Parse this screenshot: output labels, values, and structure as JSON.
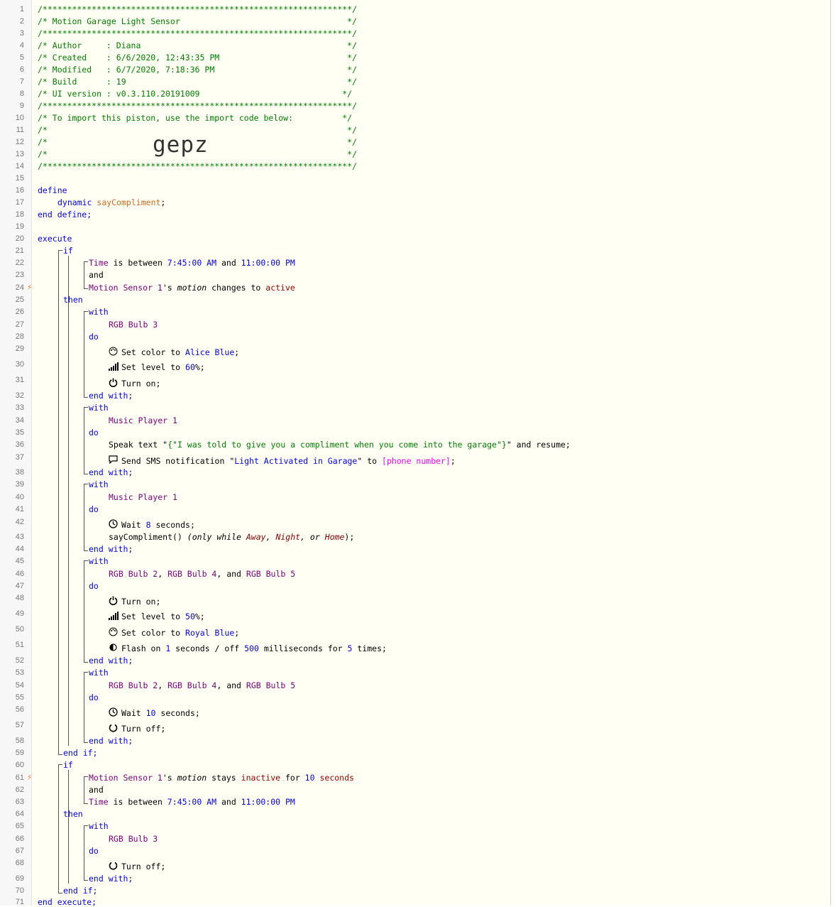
{
  "line_numbers": [
    "1",
    "2",
    "3",
    "4",
    "5",
    "6",
    "7",
    "8",
    "9",
    "10",
    "11",
    "12",
    "13",
    "14",
    "15",
    "16",
    "17",
    "18",
    "19",
    "20",
    "21",
    "22",
    "23",
    "24",
    "25",
    "26",
    "27",
    "28",
    "29",
    "30",
    "31",
    "32",
    "33",
    "34",
    "35",
    "36",
    "37",
    "38",
    "39",
    "40",
    "41",
    "42",
    "43",
    "44",
    "45",
    "46",
    "47",
    "48",
    "49",
    "50",
    "51",
    "52",
    "53",
    "54",
    "55",
    "56",
    "57",
    "58",
    "59",
    "60",
    "61",
    "62",
    "63",
    "64",
    "65",
    "66",
    "67",
    "68",
    "69",
    "70",
    "71"
  ],
  "header": {
    "border": "/***************************************************************/",
    "title": "/* Motion Garage Light Sensor                                  */",
    "author": "/* Author     : Diana                                          */",
    "created": "/* Created    : 6/6/2020, 12:43:35 PM                          */",
    "modified": "/* Modified   : 6/7/2020, 7:18:36 PM                           */",
    "build": "/* Build      : 19                                             */",
    "ui_version": "/* UI version : v0.3.110.20191009                             */",
    "import_note": "/* To import this piston, use the import code below:          */",
    "blank": "/*                                                             */",
    "import_code": "gepz"
  },
  "kw": {
    "define": "define",
    "dynamic": "dynamic",
    "end_define": "end define;",
    "execute": "execute",
    "if": "if",
    "and": "and",
    "then": "then",
    "with": "with",
    "do": "do",
    "end_with": "end with;",
    "end_if": "end if;",
    "end_execute": "end execute;"
  },
  "vars": {
    "say_compliment": "sayCompliment"
  },
  "devices": {
    "time": "Time",
    "motion_sensor": "Motion Sensor 1",
    "rgb_bulb_3": "RGB Bulb 3",
    "music_player": "Music Player 1",
    "rgb_bulb_2": "RGB Bulb 2",
    "rgb_bulb_4": "RGB Bulb 4",
    "rgb_bulb_5": "RGB Bulb 5"
  },
  "text": {
    "is_between": " is between ",
    "and_sp": " and ",
    "possessive": "'s ",
    "motion": "motion",
    "changes_to": " changes to ",
    "active": "active",
    "stays": " stays ",
    "inactive": "inactive",
    "for_sp": " for ",
    "seconds": "seconds",
    "set_color_to": "Set color to ",
    "set_level_to": "Set level to ",
    "pct": "%;",
    "turn_on": "Turn on;",
    "turn_off": "Turn off;",
    "speak_text": "Speak text \"",
    "speak_str": "{\"I was told to give you a compliment when you come into the garage\"}",
    "and_resume": "\" and resume;",
    "send_sms": "Send SMS notification \"",
    "sms_str": "Light Activated in Garage",
    "to_sp": "\" to ",
    "phone": "[phone number]",
    "semi": ";",
    "wait": "Wait ",
    "seconds_semi": " seconds;",
    "say_call": "sayCompliment() ",
    "only_while": "(only while ",
    "away": "Away",
    "comma_sp": ", ",
    "night": "Night",
    "or_sp": ", or ",
    "home": "Home",
    "close_paren": ");",
    "comma_and": ", and ",
    "flash_on": "Flash on ",
    "seconds_off": " seconds / off ",
    "ms_for": " milliseconds for ",
    "times": " times;"
  },
  "values": {
    "time_start": "7:45:00 AM",
    "time_end": "11:00:00 PM",
    "alice_blue": "Alice Blue",
    "level_60": "60",
    "level_50": "50",
    "royal_blue": "Royal Blue",
    "wait_8": "8",
    "wait_10": "10",
    "flash_on": "1",
    "flash_off": "500",
    "flash_times": "5",
    "inactive_secs": "10"
  }
}
